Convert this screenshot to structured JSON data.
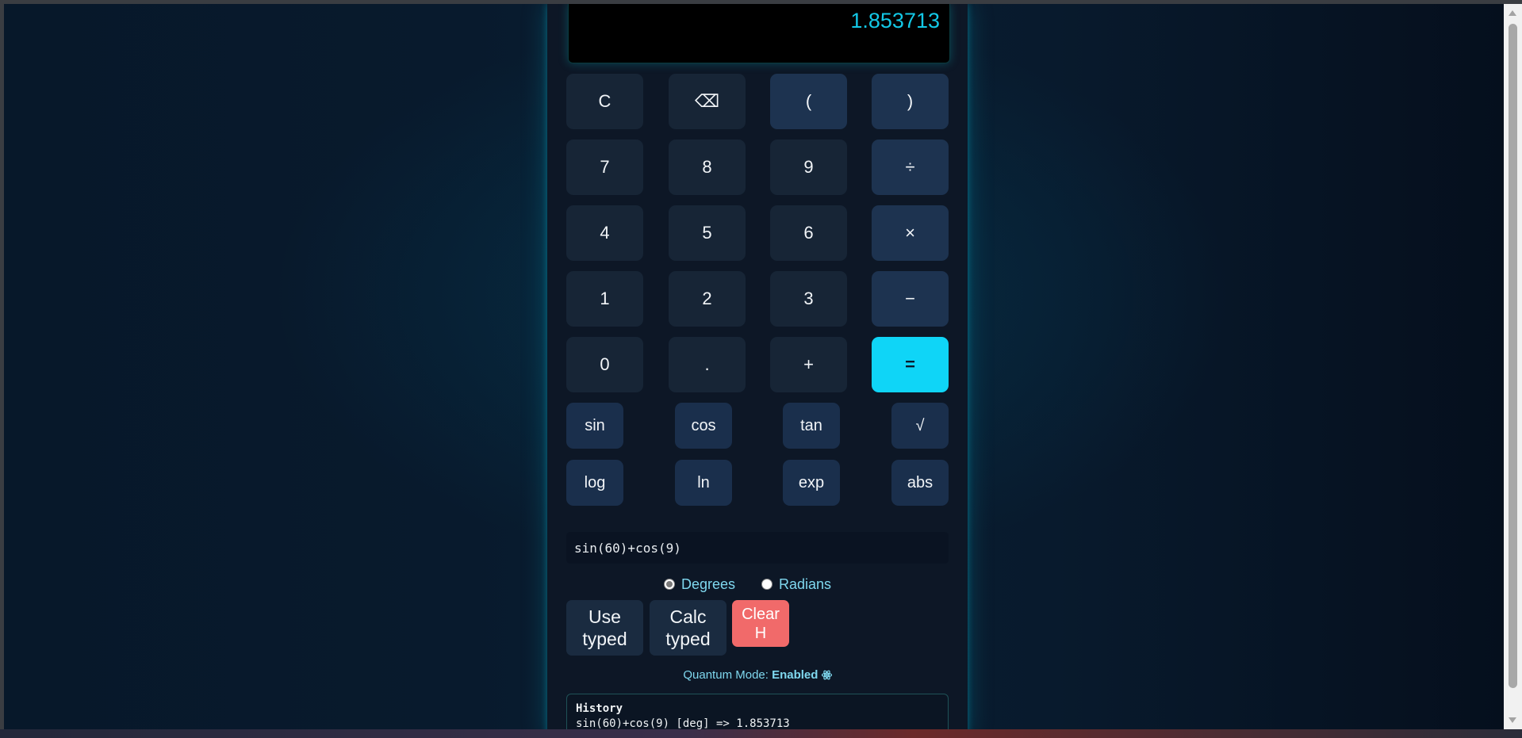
{
  "display": {
    "value": "1.853713"
  },
  "keypad": {
    "rows": [
      [
        "C",
        "⌫",
        "(",
        ")"
      ],
      [
        "7",
        "8",
        "9",
        "÷"
      ],
      [
        "4",
        "5",
        "6",
        "×"
      ],
      [
        "1",
        "2",
        "3",
        "−"
      ],
      [
        "0",
        ".",
        "+",
        "="
      ]
    ]
  },
  "functions": {
    "row1": [
      "sin",
      "cos",
      "tan",
      "√"
    ],
    "row2": [
      "log",
      "ln",
      "exp",
      "abs"
    ]
  },
  "expression_input": {
    "value": "sin(60)+cos(9)"
  },
  "angle_mode": {
    "degrees_label": "Degrees",
    "radians_label": "Radians",
    "selected": "Degrees"
  },
  "actions": {
    "use_typed_line1": "Use",
    "use_typed_line2": "typed",
    "calc_typed_line1": "Calc",
    "calc_typed_line2": "typed",
    "clear_history_line1": "Clear",
    "clear_history_line2": "H"
  },
  "quantum": {
    "label": "Quantum Mode:",
    "status": "Enabled",
    "icon": "atom-icon"
  },
  "history": {
    "title": "History",
    "entries": [
      "sin(60)+cos(9) [deg] => 1.853713"
    ]
  },
  "colors": {
    "accent": "#0fd5f7",
    "display_text": "#13c8e6",
    "danger": "#f16a6a",
    "panel": "#0d1726"
  }
}
